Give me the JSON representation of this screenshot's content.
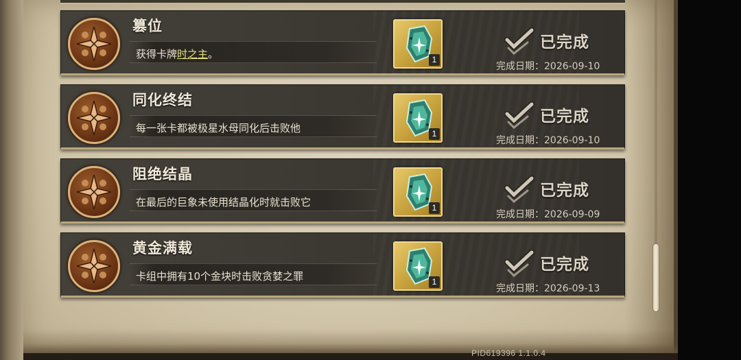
{
  "achievements": [
    {
      "title": "篡位",
      "desc_prefix": "获得卡牌",
      "desc_highlight": "时之主",
      "desc_suffix": "。",
      "reward_count": "1",
      "status": "已完成",
      "date": "完成日期：2026-09-10"
    },
    {
      "title": "同化终结",
      "desc_prefix": "每一张卡都被极星水母同化后击败他",
      "desc_highlight": "",
      "desc_suffix": "",
      "reward_count": "1",
      "status": "已完成",
      "date": "完成日期：2026-09-10"
    },
    {
      "title": "阻绝结晶",
      "desc_prefix": "在最后的巨象未使用结晶化时就击败它",
      "desc_highlight": "",
      "desc_suffix": "",
      "reward_count": "1",
      "status": "已完成",
      "date": "完成日期：2026-09-09"
    },
    {
      "title": "黄金满载",
      "desc_prefix": "卡组中拥有10个金块时击败贪婪之罪",
      "desc_highlight": "",
      "desc_suffix": "",
      "reward_count": "1",
      "status": "已完成",
      "date": "完成日期：2026-09-13"
    }
  ],
  "icons": {
    "medal": "compass-medal-icon",
    "reward": "crystal-card-icon",
    "status": "checkmark-icon"
  },
  "colors": {
    "highlight": "#e6e27a",
    "reward_frame": "#e6c86a",
    "medal": "#6b3515"
  },
  "footer": {
    "version": "PID619396  1.1.0.4"
  }
}
